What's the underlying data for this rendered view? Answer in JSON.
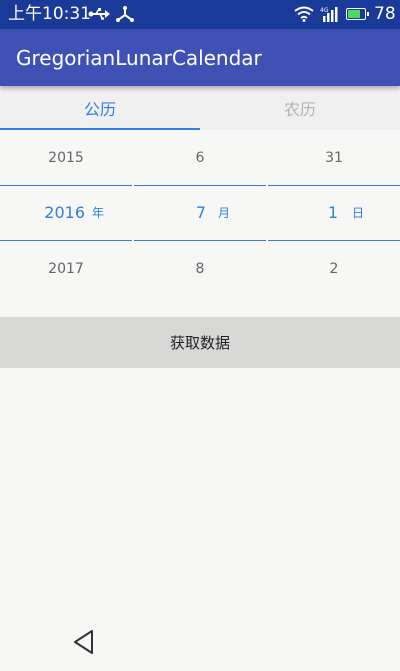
{
  "status_bar": {
    "time": "上午10:31",
    "battery_percent": "78",
    "battery_level": 0.78,
    "icons": [
      "usb-icon",
      "share-icon",
      "wifi-icon",
      "signal-4g-icon",
      "battery-icon"
    ]
  },
  "app_bar": {
    "title": "GregorianLunarCalendar"
  },
  "tabs": [
    {
      "label": "公历",
      "active": true
    },
    {
      "label": "农历",
      "active": false
    }
  ],
  "picker": {
    "columns": [
      {
        "name": "year",
        "prev": "2015",
        "selected": "2016",
        "unit": "年",
        "next": "2017"
      },
      {
        "name": "month",
        "prev": "6",
        "selected": "7",
        "unit": "月",
        "next": "8"
      },
      {
        "name": "day",
        "prev": "31",
        "selected": "1",
        "unit": "日",
        "next": "2"
      }
    ]
  },
  "actions": {
    "get_data_label": "获取数据"
  },
  "nav": {
    "back_icon": "back-triangle-icon"
  },
  "colors": {
    "status_bar": "#1a3a99",
    "app_bar": "#3f51b5",
    "accent": "#2f7fe0",
    "background": "#f7f7f5",
    "button": "#d7d7d5"
  }
}
